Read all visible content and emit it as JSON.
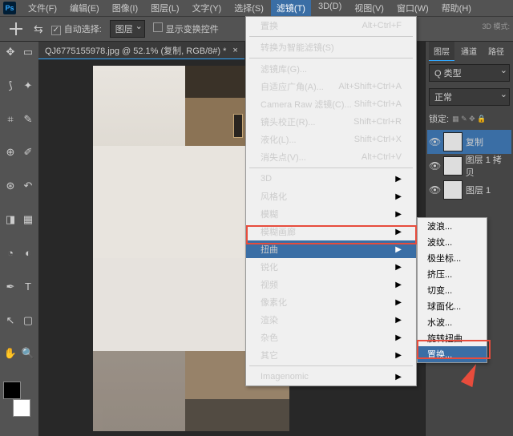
{
  "menubar": {
    "items": [
      "文件(F)",
      "编辑(E)",
      "图像(I)",
      "图层(L)",
      "文字(Y)",
      "选择(S)",
      "滤镜(T)",
      "3D(D)",
      "视图(V)",
      "窗口(W)",
      "帮助(H)"
    ],
    "active": 6
  },
  "options": {
    "auto_select": "自动选择:",
    "layer_dd": "图层",
    "show_transform": "显示变换控件",
    "mode_3d": "3D 模式:"
  },
  "doc": {
    "title": "QJ6775155978.jpg @ 52.1% (复制, RGB/8#) *"
  },
  "filter_menu": [
    {
      "t": "i",
      "label": "置换",
      "shortcut": "Alt+Ctrl+F"
    },
    {
      "t": "sep"
    },
    {
      "t": "i",
      "label": "转换为智能滤镜(S)"
    },
    {
      "t": "sep"
    },
    {
      "t": "i",
      "label": "滤镜库(G)..."
    },
    {
      "t": "i",
      "label": "自适应广角(A)...",
      "shortcut": "Alt+Shift+Ctrl+A"
    },
    {
      "t": "i",
      "label": "Camera Raw 滤镜(C)...",
      "shortcut": "Shift+Ctrl+A"
    },
    {
      "t": "i",
      "label": "镜头校正(R)...",
      "shortcut": "Shift+Ctrl+R"
    },
    {
      "t": "i",
      "label": "液化(L)...",
      "shortcut": "Shift+Ctrl+X"
    },
    {
      "t": "i",
      "label": "消失点(V)...",
      "shortcut": "Alt+Ctrl+V"
    },
    {
      "t": "sep"
    },
    {
      "t": "i",
      "label": "3D",
      "sub": true
    },
    {
      "t": "i",
      "label": "风格化",
      "sub": true
    },
    {
      "t": "i",
      "label": "模糊",
      "sub": true
    },
    {
      "t": "i",
      "label": "模糊画廊",
      "sub": true
    },
    {
      "t": "i",
      "label": "扭曲",
      "sub": true,
      "hl": true
    },
    {
      "t": "i",
      "label": "锐化",
      "sub": true
    },
    {
      "t": "i",
      "label": "视频",
      "sub": true
    },
    {
      "t": "i",
      "label": "像素化",
      "sub": true
    },
    {
      "t": "i",
      "label": "渲染",
      "sub": true
    },
    {
      "t": "i",
      "label": "杂色",
      "sub": true
    },
    {
      "t": "i",
      "label": "其它",
      "sub": true
    },
    {
      "t": "sep"
    },
    {
      "t": "i",
      "label": "Imagenomic",
      "sub": true
    }
  ],
  "distort_submenu": [
    "波浪...",
    "波纹...",
    "极坐标...",
    "挤压...",
    "切变...",
    "球面化...",
    "水波...",
    "旋转扭曲...",
    "置换..."
  ],
  "submenu_hl": 8,
  "panels": {
    "tabs": [
      "图层",
      "通道",
      "路径"
    ],
    "type_dd": "Q 类型",
    "blend": "正常",
    "lock": "锁定:",
    "layers": [
      {
        "name": "复制",
        "active": true
      },
      {
        "name": "图层 1 拷贝"
      },
      {
        "name": "图层 1"
      }
    ]
  }
}
